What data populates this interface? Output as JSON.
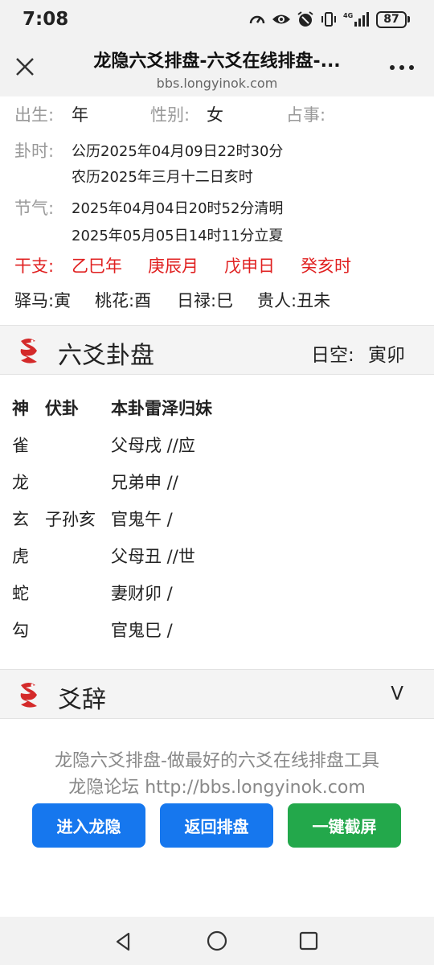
{
  "status": {
    "time": "7:08",
    "battery": "87",
    "network": "4G"
  },
  "browser": {
    "title": "龙隐六爻排盘-六爻在线排盘-...",
    "url": "bbs.longyinok.com"
  },
  "info": {
    "birth_label": "出生:",
    "birth_value": "年",
    "gender_label": "性别:",
    "gender_value": "女",
    "matter_label": "占事:",
    "time_label": "卦时:",
    "time_solar": "公历2025年04月09日22时30分",
    "time_lunar": "农历2025年三月十二日亥时",
    "jieqi_label": "节气:",
    "jieqi_1": "2025年04月04日20时52分清明",
    "jieqi_2": "2025年05月05日14时11分立夏",
    "ganzhi_label": "干支:",
    "ganzhi": [
      "乙巳年",
      "庚辰月",
      "戊申日",
      "癸亥时"
    ],
    "shensha": [
      "驿马:寅",
      "桃花:酉",
      "日禄:巳",
      "贵人:丑未"
    ]
  },
  "section_paipan": {
    "title": "六爻卦盘",
    "kong_label": "日空:",
    "kong_value": "寅卯"
  },
  "gua_table": {
    "headers": [
      "神",
      "伏卦",
      "本卦雷泽归妹"
    ],
    "rows": [
      {
        "shen": "雀",
        "fu": "",
        "ben": "父母戌 //应"
      },
      {
        "shen": "龙",
        "fu": "",
        "ben": "兄弟申 //"
      },
      {
        "shen": "玄",
        "fu": "子孙亥",
        "ben": "官鬼午  /"
      },
      {
        "shen": "虎",
        "fu": "",
        "ben": "父母丑 //世"
      },
      {
        "shen": "蛇",
        "fu": "",
        "ben": "妻财卯  /"
      },
      {
        "shen": "勾",
        "fu": "",
        "ben": "官鬼巳  /"
      }
    ]
  },
  "section_yaoci": {
    "title": "爻辞",
    "toggle": "V"
  },
  "footer": {
    "line1": "龙隐六爻排盘-做最好的六爻在线排盘工具",
    "line2": "龙隐论坛 http://bbs.longyinok.com",
    "btn_enter": "进入龙隐",
    "btn_back": "返回排盘",
    "btn_screenshot": "一键截屏"
  },
  "colors": {
    "red": "#e02020",
    "blue_button": "#1677ee",
    "green_button": "#23a84b",
    "gray_label": "#999999",
    "dragon_red": "#d42a2a"
  }
}
